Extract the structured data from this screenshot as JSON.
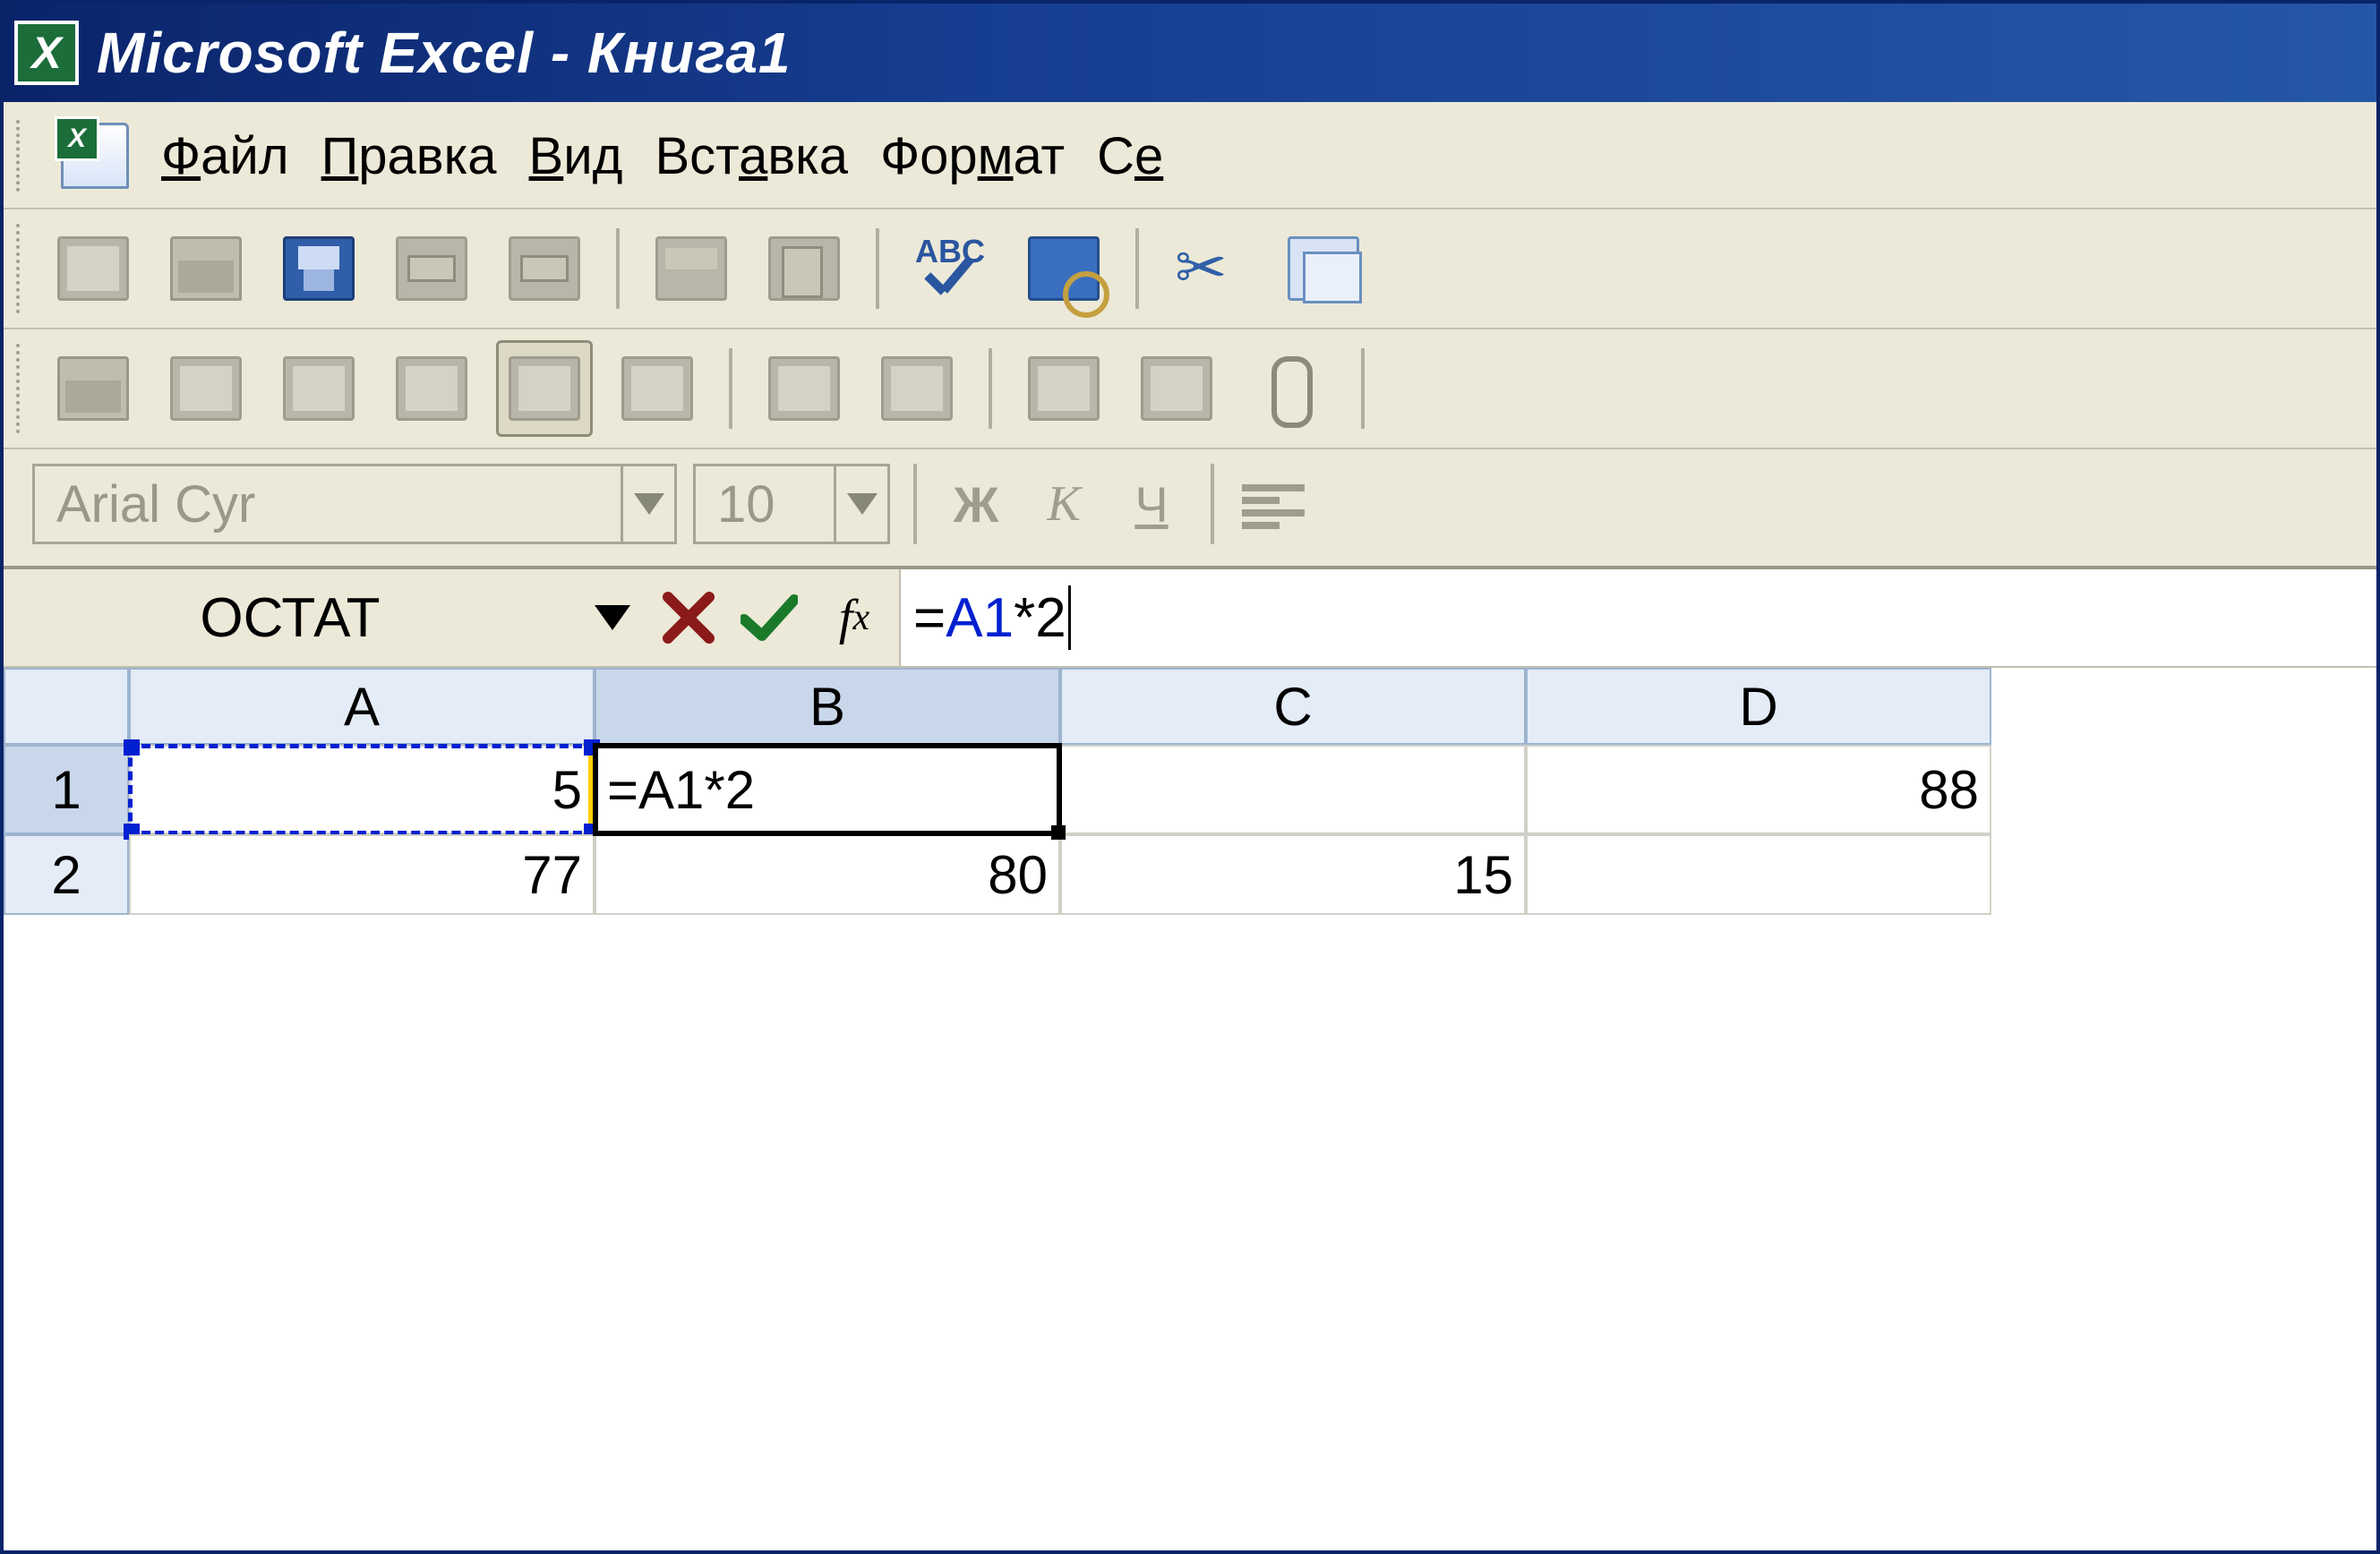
{
  "title": "Microsoft Excel - Книга1",
  "menu": {
    "file": {
      "pre": "",
      "u": "Ф",
      "post": "айл"
    },
    "edit": {
      "pre": "",
      "u": "П",
      "post": "равка"
    },
    "view": {
      "pre": "",
      "u": "В",
      "post": "ид"
    },
    "insert": {
      "pre": "Вст",
      "u": "а",
      "post": "вка"
    },
    "format": {
      "pre": "Фор",
      "u": "м",
      "post": "ат"
    },
    "service": {
      "pre": "С",
      "u": "е",
      "post": ""
    }
  },
  "toolbar_icons": {
    "new": "new-icon",
    "open": "open-icon",
    "save": "save-icon",
    "mail": "mail-icon",
    "print": "print-icon",
    "preview": "preview-icon",
    "zoom": "zoom-icon",
    "spell": "spell-icon",
    "research": "research-icon",
    "cut": "cut-icon",
    "copy": "copy-icon"
  },
  "spell_abc": "ABC",
  "format_toolbar": {
    "font_name": "Arial Cyr",
    "font_size": "10",
    "bold": "Ж",
    "italic": "К",
    "underline": "Ч"
  },
  "formula_bar": {
    "name_box": "ОСТАТ",
    "fx": "f",
    "fx_sub": "x",
    "formula_eq": "=",
    "formula_ref": "A1",
    "formula_rest": "*2"
  },
  "grid": {
    "columns": [
      "A",
      "B",
      "C",
      "D"
    ],
    "rows": [
      "1",
      "2"
    ],
    "cells": {
      "A1": "5",
      "B1": "=A1*2",
      "C1": "",
      "D1": "88",
      "A2": "77",
      "B2": "80",
      "C2": "15",
      "D2": ""
    },
    "active_cell": "B1",
    "ref_source": "A1"
  }
}
